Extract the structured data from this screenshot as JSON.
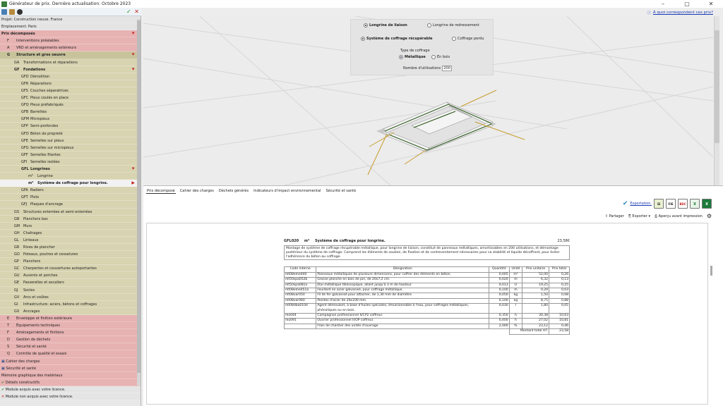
{
  "window": {
    "title": "Générateur de prix. Dernière actualisation: Octobre 2023",
    "min": "–",
    "max": "▢",
    "close": "✕"
  },
  "toolbar": {
    "ok": "✓",
    "close": "✕"
  },
  "sidebar": {
    "project_line": "Projet: Construction neuve. France",
    "location_line": "Emplacement: Paris",
    "items": [
      {
        "code": "",
        "label": "Prix décomposés",
        "bg": "pink",
        "bold": true,
        "arrow": "⯆",
        "indent": 2
      },
      {
        "code": "F",
        "label": "Interventions préalables",
        "bg": "pink",
        "indent": 10
      },
      {
        "code": "A",
        "label": "VRD et aménagements extérieurs",
        "bg": "pink",
        "indent": 10
      },
      {
        "code": "G",
        "label": "Structure et gros oeuvre",
        "bg": "olive",
        "bold": true,
        "arrow": "⯆",
        "indent": 10
      },
      {
        "code": "GA",
        "label": "Transformations et réparations",
        "bg": "olive2",
        "indent": 20
      },
      {
        "code": "GF",
        "label": "Fondations",
        "bg": "olive2",
        "bold": true,
        "arrow": "⯆",
        "indent": 20
      },
      {
        "code": "GFD",
        "label": "Démolition",
        "bg": "olive2",
        "indent": 30
      },
      {
        "code": "GFR",
        "label": "Réparations",
        "bg": "olive2",
        "indent": 30
      },
      {
        "code": "GFS",
        "label": "Couches séparatrices",
        "bg": "olive2",
        "indent": 30
      },
      {
        "code": "GFC",
        "label": "Pieux coulés en place",
        "bg": "olive2",
        "indent": 30
      },
      {
        "code": "GFQ",
        "label": "Pieux préfabriqués",
        "bg": "olive2",
        "indent": 30
      },
      {
        "code": "GFB",
        "label": "Barrettes",
        "bg": "olive2",
        "indent": 30
      },
      {
        "code": "GFM",
        "label": "Micropieux",
        "bg": "olive2",
        "indent": 30
      },
      {
        "code": "GFP",
        "label": "Semi-profondes",
        "bg": "olive2",
        "indent": 30
      },
      {
        "code": "GFO",
        "label": "Béton de propreté",
        "bg": "olive2",
        "indent": 30
      },
      {
        "code": "GFE",
        "label": "Semelles sur pieux",
        "bg": "olive2",
        "indent": 30
      },
      {
        "code": "GFG",
        "label": "Semelles sur micropieux",
        "bg": "olive2",
        "indent": 30
      },
      {
        "code": "GFF",
        "label": "Semelles filantes",
        "bg": "olive2",
        "indent": 30
      },
      {
        "code": "GFI",
        "label": "Semelles isolées",
        "bg": "olive2",
        "indent": 30
      },
      {
        "code": "GFL",
        "label": "Longrines",
        "bg": "olive2",
        "bold": true,
        "arrow": "⯆",
        "indent": 30
      },
      {
        "code": "m²",
        "label": "Longrine",
        "bg": "olive2",
        "indent": 40
      },
      {
        "code": "m²",
        "label": "Système de coffrage pour longrine.",
        "bg": "sel",
        "bold": true,
        "arrow": "▶",
        "indent": 40
      },
      {
        "code": "GFA",
        "label": "Radiers",
        "bg": "olive2",
        "indent": 30
      },
      {
        "code": "GFT",
        "label": "Plots",
        "bg": "olive2",
        "indent": 30
      },
      {
        "code": "GFJ",
        "label": "Plaques d'ancrage",
        "bg": "olive2",
        "indent": 30
      },
      {
        "code": "GS",
        "label": "Structures enterrées et semi-enterrées",
        "bg": "olive2",
        "indent": 20
      },
      {
        "code": "GB",
        "label": "Planchers bas",
        "bg": "olive2",
        "indent": 20
      },
      {
        "code": "GM",
        "label": "Murs",
        "bg": "olive2",
        "indent": 20
      },
      {
        "code": "GH",
        "label": "Chaînages",
        "bg": "olive2",
        "indent": 20
      },
      {
        "code": "GL",
        "label": "Linteaux",
        "bg": "olive2",
        "indent": 20
      },
      {
        "code": "GR",
        "label": "Rives de plancher",
        "bg": "olive2",
        "indent": 20
      },
      {
        "code": "GO",
        "label": "Poteaux, poutres et cessatures",
        "bg": "olive2",
        "indent": 20
      },
      {
        "code": "GP",
        "label": "Planchers",
        "bg": "olive2",
        "indent": 20
      },
      {
        "code": "GC",
        "label": "Charpentes et couvertures autoportantes",
        "bg": "olive2",
        "indent": 20
      },
      {
        "code": "GU",
        "label": "Auvents et porches",
        "bg": "olive2",
        "indent": 20
      },
      {
        "code": "GE",
        "label": "Passerelles et escaliers",
        "bg": "olive2",
        "indent": 20
      },
      {
        "code": "GJ",
        "label": "Socles",
        "bg": "olive2",
        "indent": 20
      },
      {
        "code": "GV",
        "label": "Arcs et voûtes",
        "bg": "olive2",
        "indent": 20
      },
      {
        "code": "GI",
        "label": "Infrastructure: aciers, bétons et coffrages",
        "bg": "olive2",
        "indent": 20
      },
      {
        "code": "GX",
        "label": "Ancrages",
        "bg": "olive2",
        "indent": 20
      },
      {
        "code": "E",
        "label": "Enveloppe et finition extérieure",
        "bg": "pink",
        "indent": 10
      },
      {
        "code": "T",
        "label": "Équipements techniques",
        "bg": "pink",
        "indent": 10
      },
      {
        "code": "F",
        "label": "Aménagements et finitions",
        "bg": "pink",
        "indent": 10
      },
      {
        "code": "D",
        "label": "Gestion de déchets",
        "bg": "pink",
        "indent": 10
      },
      {
        "code": "S",
        "label": "Sécurité et santé",
        "bg": "pink",
        "indent": 10
      },
      {
        "code": "Q",
        "label": "Contrôle de qualité et essais",
        "bg": "pink",
        "indent": 10
      },
      {
        "code": "",
        "label": "Cahier des charges",
        "bg": "pink",
        "indent": 2,
        "icon": true
      },
      {
        "code": "",
        "label": "Sécurité et santé",
        "bg": "pink",
        "indent": 2,
        "icon": true
      },
      {
        "code": "",
        "label": "Mémoire graphique des matériaux",
        "bg": "pink",
        "indent": 2
      },
      {
        "code": "",
        "label": "Détails constructifs",
        "bg": "pink",
        "indent": 2,
        "check": true
      },
      {
        "code": "",
        "label": "Module acquis avec votre licence.",
        "bg": "grey",
        "indent": 2,
        "check": true
      },
      {
        "code": "",
        "label": "Module non acquis avec votre licence.",
        "bg": "grey",
        "indent": 2,
        "cross": true
      }
    ]
  },
  "help": {
    "label": "À quoi correspondent ces prix?"
  },
  "options": {
    "type_longrine_1": "Longrine de liaison",
    "type_longrine_2": "Longrine de redressement",
    "coffrage_1": "Système de coffrage récupérable",
    "coffrage_2": "Coffrage perdu",
    "type_label": "Type de coffrage",
    "type_1": "Métallique",
    "type_2": "En bois",
    "uses_label": "Nombre d'utilisations",
    "uses_value": "200"
  },
  "tabs": [
    "Prix décomposé",
    "Cahier des charges",
    "Déchets générés",
    "Indicateurs d'impact environnemental",
    "Sécurité et santé"
  ],
  "export": {
    "link": "Exportation.",
    "fie": "FIE",
    "bdc": "BDC"
  },
  "actions": {
    "share": "Partager",
    "export": "Exporter",
    "preview": "Aperçu avant impression"
  },
  "doc": {
    "code": "GFL020",
    "unit": "m²",
    "title": "Système de coffrage pour longrine.",
    "price": "23,58€",
    "description": "Montage de système de coffrage récupérable métallique, pour longrine de liaison, constitué de panneaux métalliques, amortissables en 200 utilisations, et démontage postérieur du système de coffrage. Comprend les éléments de soutien, de fixation et de contreventement nécessaires pour sa stabilité et liquide décoffrant, pour éviter l'adhérence du béton au coffrage.",
    "headers": [
      "Code interne",
      "Désignation",
      "Quantité",
      "Unité",
      "Prix unitaire",
      "Prix total"
    ],
    "rows": [
      [
        "mt08eme040",
        "Panneaux métalliques de plusieurs dimensions, pour coffrer des éléments en béton.",
        "0,005",
        "m²",
        "52,00",
        "0,26"
      ],
      [
        "mt50spa052b",
        "Grosse planche en bois de pin, de 20x7,2 cm.",
        "0,020",
        "m",
        "6,32",
        "0,13"
      ],
      [
        "mt50spa081a",
        "Étai métallique télescopique, allant jusqu'à 3 m de hauteur.",
        "0,013",
        "U",
        "19,25",
        "0,25"
      ],
      [
        "mt08eme051a",
        "Feuillard en acier galvanisé, pour coffrage métallique.",
        "0,100",
        "m",
        "0,29",
        "0,03"
      ],
      [
        "mt08var050",
        "Fil de fer galvanisé pour attacher, de 1,30 mm de diamètre.",
        "0,050",
        "kg",
        "1,50",
        "0,08"
      ],
      [
        "mt08var060",
        "Pointes d'acier de 20x100 mm.",
        "0,100",
        "kg",
        "8,75",
        "0,88"
      ],
      [
        "mt08dba010d",
        "Agent démoulant, à base d'huiles spéciales, émulsionnable à l'eau, pour coffrages métalliques, phénoliques ou en bois.",
        "0,030",
        "l",
        "1,80",
        "0,05"
      ],
      [
        "mo044",
        "Compagnon professionnel II/CP2 coffreur.",
        "0,350",
        "h",
        "30,38",
        "10,63"
      ],
      [
        "mo091",
        "Ouvrier professionnel II/OP coffreur.",
        "0,400",
        "h",
        "27,02",
        "10,81"
      ],
      [
        "",
        "Frais de chantier des unités d'ouvrage",
        "2,000",
        "%",
        "23,12",
        "0,46"
      ]
    ],
    "total_label": "Montant total HT:",
    "total_value": "23,58"
  }
}
